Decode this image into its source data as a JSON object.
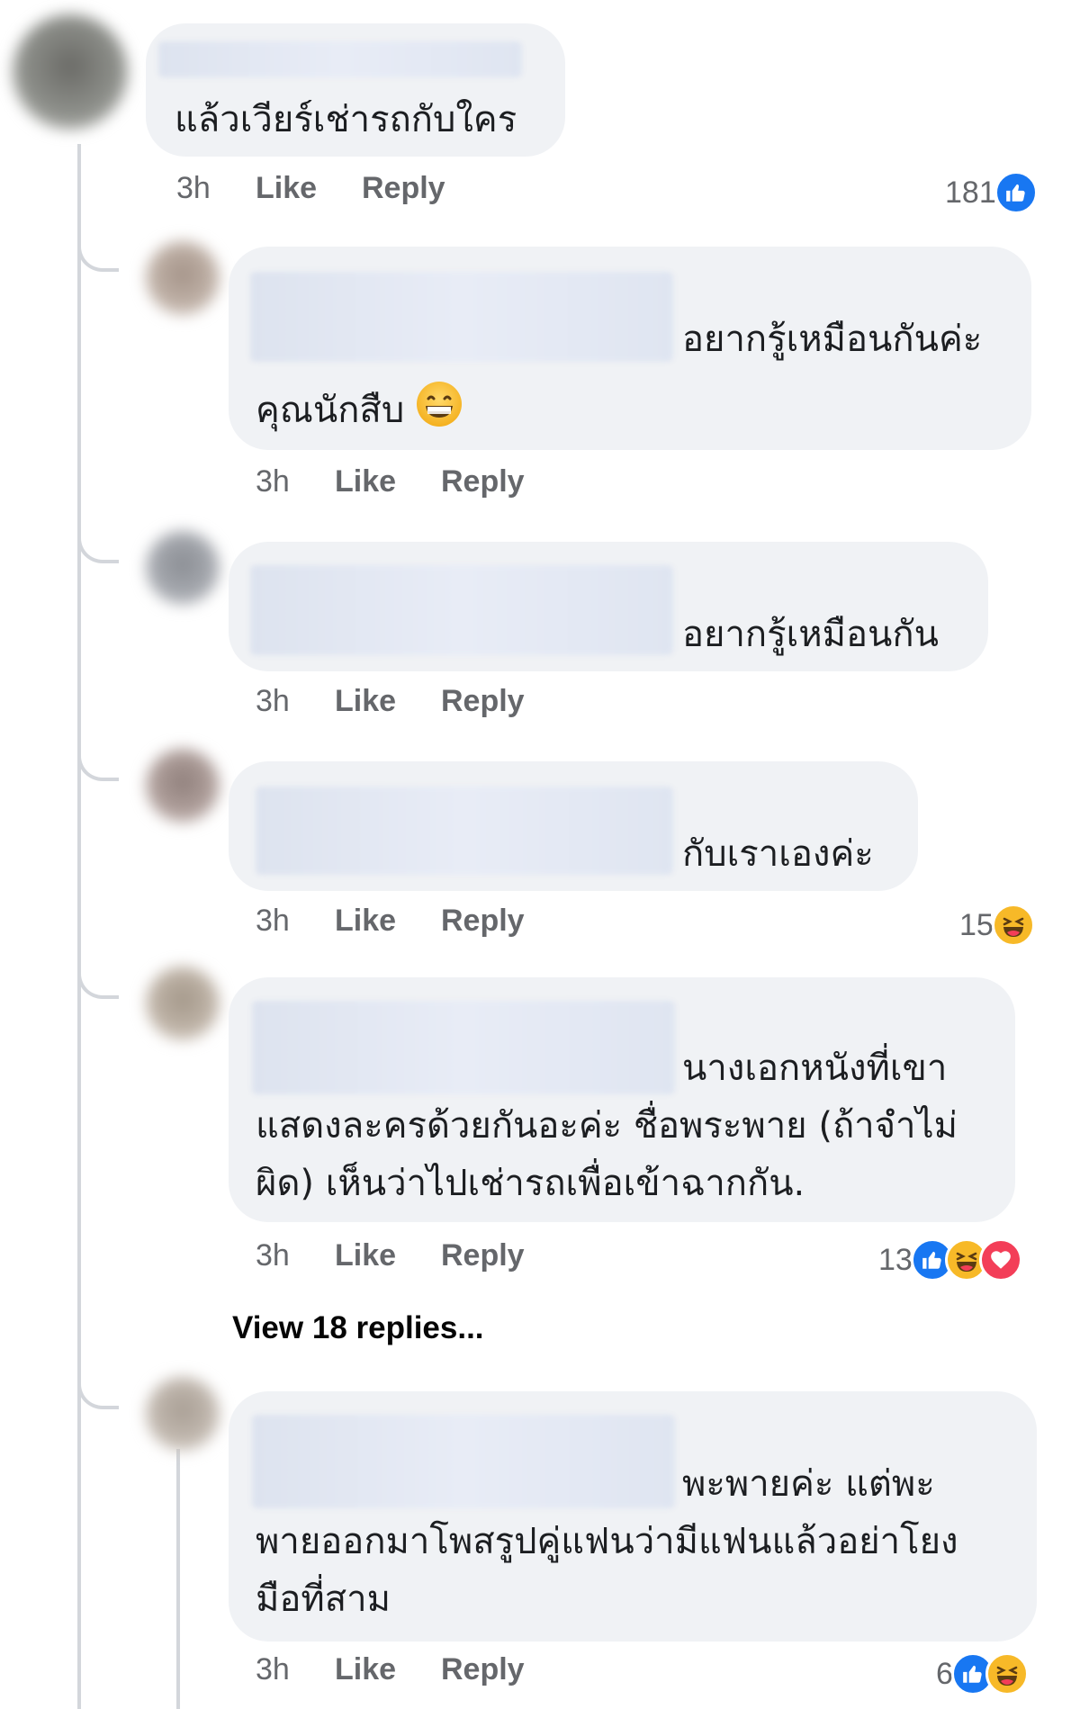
{
  "comments": [
    {
      "text_lines": [
        "แล้วเวียร์เช่ารถกับใคร"
      ],
      "time": "3h",
      "like_label": "Like",
      "reply_label": "Reply",
      "reaction_count": "181",
      "reactions": [
        "like-icon"
      ]
    },
    {
      "text_lines": [
        "อยากรู้เหมือนกันค่ะ",
        "คุณนักสืบ"
      ],
      "emoji": "grinning-face-icon",
      "time": "3h",
      "like_label": "Like",
      "reply_label": "Reply"
    },
    {
      "text_lines": [
        "อยากรู้เหมือนกัน"
      ],
      "time": "3h",
      "like_label": "Like",
      "reply_label": "Reply"
    },
    {
      "text_lines": [
        "กับเราเองค่ะ"
      ],
      "time": "3h",
      "like_label": "Like",
      "reply_label": "Reply",
      "reaction_count": "15",
      "reactions": [
        "haha-icon"
      ]
    },
    {
      "text_lines": [
        "นางเอกหนังที่เขา",
        "แสดงละครด้วยกันอะค่ะ ชื่อพระพาย (ถ้าจำไม่",
        "ผิด) เห็นว่าไปเช่ารถเพื่อเข้าฉากกัน."
      ],
      "time": "3h",
      "like_label": "Like",
      "reply_label": "Reply",
      "reaction_count": "13",
      "reactions": [
        "like-icon",
        "haha-icon",
        "love-icon"
      ]
    },
    {
      "text_lines": [
        "พะพายค่ะ แต่พะ",
        "พายออกมาโพสรูปคู่แฟนว่ามีแฟนแล้วอย่าโยง",
        "มือที่สาม"
      ],
      "time": "3h",
      "like_label": "Like",
      "reply_label": "Reply",
      "reaction_count": "6",
      "reactions": [
        "like-icon",
        "haha-icon"
      ]
    }
  ],
  "view_replies_label": "View 18 replies...",
  "colors": {
    "bubble": "#f0f2f5",
    "meta_text": "#65676b",
    "like": "#1877f2",
    "haha": "#f7b928",
    "love": "#f33e58"
  }
}
